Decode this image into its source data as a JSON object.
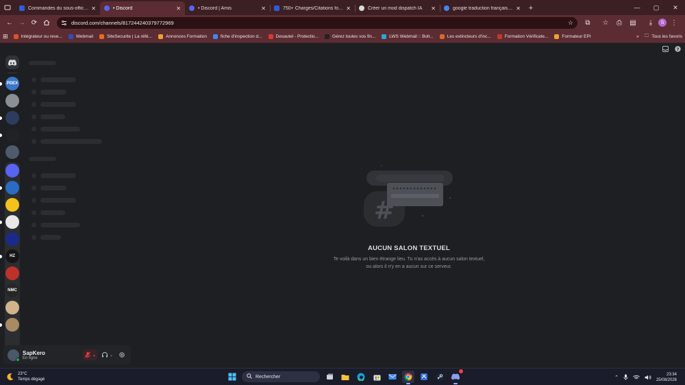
{
  "browser": {
    "tabs": [
      {
        "title": "Commandes du sous-officier le",
        "icon": "pp-icon",
        "color": "#2f5bd8",
        "active": false
      },
      {
        "title": "• Discord",
        "icon": "discord-icon",
        "color": "#5865f2",
        "active": true
      },
      {
        "title": "• Discord | Amis",
        "icon": "discord-icon",
        "color": "#5865f2",
        "active": false
      },
      {
        "title": "750+ Charges/Citations for pdf",
        "icon": "pp-icon",
        "color": "#2f5bd8",
        "active": false
      },
      {
        "title": "Créer un mod dispatch IA",
        "icon": "chatgpt-icon",
        "color": "#d9d9d9",
        "active": false
      },
      {
        "title": "google traduction français - Re",
        "icon": "google-icon",
        "color": "#4285f4",
        "active": false
      }
    ],
    "url": "discord.com/channels/817244240379772969",
    "profile_initial": "S",
    "bookmarks": [
      {
        "label": "Intégrateur ou reve...",
        "color": "#e14f2a"
      },
      {
        "label": "Webmail",
        "color": "#2a4fbf"
      },
      {
        "label": "SiteSecurite | La réfé...",
        "color": "#e86a1b"
      },
      {
        "label": "Annonces Formation",
        "color": "#f0a030"
      },
      {
        "label": "fiche d'inspection d...",
        "color": "#4285f4"
      },
      {
        "label": "Desautel - Protectio...",
        "color": "#d93a2e"
      },
      {
        "label": "Gérez toutes vos fin...",
        "color": "#222222"
      },
      {
        "label": "LWS Webmail :: Bolt...",
        "color": "#2aa6d9"
      },
      {
        "label": "Les extincteurs d'inc...",
        "color": "#d86a2a"
      },
      {
        "label": "Formation Vérificate...",
        "color": "#c4372c"
      },
      {
        "label": "Formateur EPI",
        "color": "#f0a030"
      }
    ],
    "all_bookmarks": "Tous les favoris"
  },
  "discord": {
    "servers": [
      {
        "label": "PDEX",
        "color": "#3b76c9",
        "pip": true
      },
      {
        "label": "",
        "color": "#8a8f96",
        "pip": false
      },
      {
        "label": "",
        "color": "#2d3b5e",
        "pip": true
      },
      {
        "label": "",
        "color": "#202226",
        "pip": true
      },
      {
        "label": "",
        "color": "#4d5b6a",
        "pip": false
      }
    ],
    "folder_servers": [
      {
        "label": "",
        "color": "#5865f2",
        "pip": false
      },
      {
        "label": "",
        "color": "#2a6bc4",
        "pip": true
      },
      {
        "label": "",
        "color": "#f4c21b",
        "pip": false
      },
      {
        "label": "",
        "color": "#e8e8e8",
        "pip": true
      },
      {
        "label": "",
        "color": "#1b2a8a",
        "pip": false
      },
      {
        "label": "HZ",
        "color": "#151515",
        "pip": true
      },
      {
        "label": "",
        "color": "#c0312a",
        "pip": false
      },
      {
        "label": "NMC",
        "color": "#262626",
        "pip": false
      },
      {
        "label": "",
        "color": "#d1b48c",
        "pip": false
      },
      {
        "label": "",
        "color": "#a88a63",
        "pip": true
      },
      {
        "label": "",
        "color": "#2b2d31",
        "pip": false
      }
    ],
    "empty_title": "AUCUN SALON TEXTUEL",
    "empty_desc": "Te voilà dans un bien étrange lieu. Tu n'as accès à aucun salon textuel, ou alors il n'y en a aucun sur ce serveur.",
    "user": {
      "name": "SapKero",
      "status": "En ligne"
    }
  },
  "taskbar": {
    "weather_temp": "23°C",
    "weather_desc": "Temps dégagé",
    "search_label": "Rechercher",
    "time": "23:34",
    "date": "25/08/2026"
  },
  "colors": {
    "accent": "#5865f2",
    "background": "#1e1f22",
    "skeleton": "#2b2d31",
    "browser_frame": "#5b2d33"
  }
}
